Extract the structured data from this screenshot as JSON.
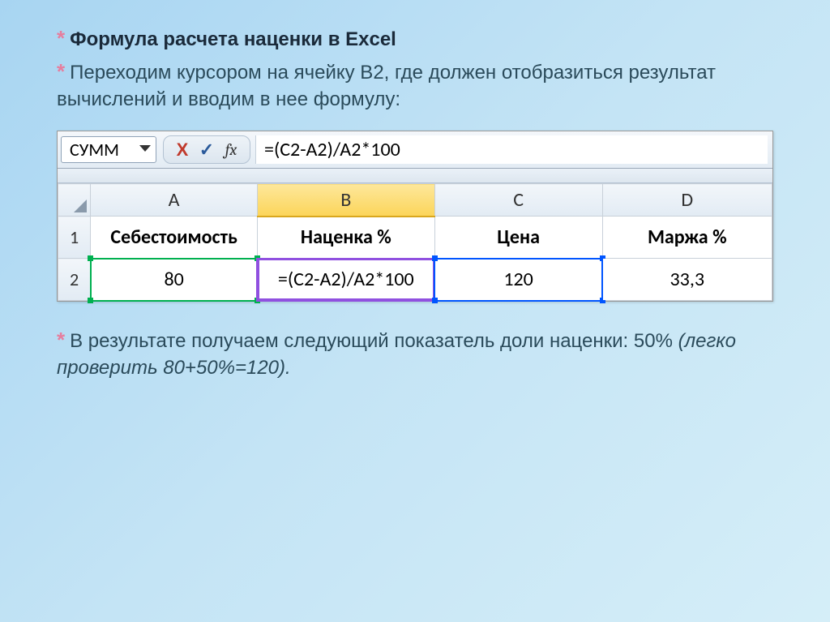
{
  "title": "Формула расчета наценки в Excel",
  "intro": "Переходим курсором на ячейку B2, где должен отобразиться результат вычислений и вводим в нее формулу:",
  "result_a": "В результате получаем следующий показатель доли наценки: 50% ",
  "result_b": "(легко проверить 80+50%=120).",
  "name_box": "СУММ",
  "fbar": {
    "x": "X",
    "check": "✓",
    "fx": "fx"
  },
  "formula_text": "=(C2-A2)/A2*100",
  "columns": [
    "A",
    "B",
    "C",
    "D"
  ],
  "rows": [
    "1",
    "2"
  ],
  "headers": {
    "A1": "Себестоимость",
    "B1": "Наценка %",
    "C1": "Цена",
    "D1": "Маржа %"
  },
  "cells": {
    "A2": "80",
    "B2": "=(C2-A2)/A2*100",
    "C2": "120",
    "D2": "33,3"
  }
}
